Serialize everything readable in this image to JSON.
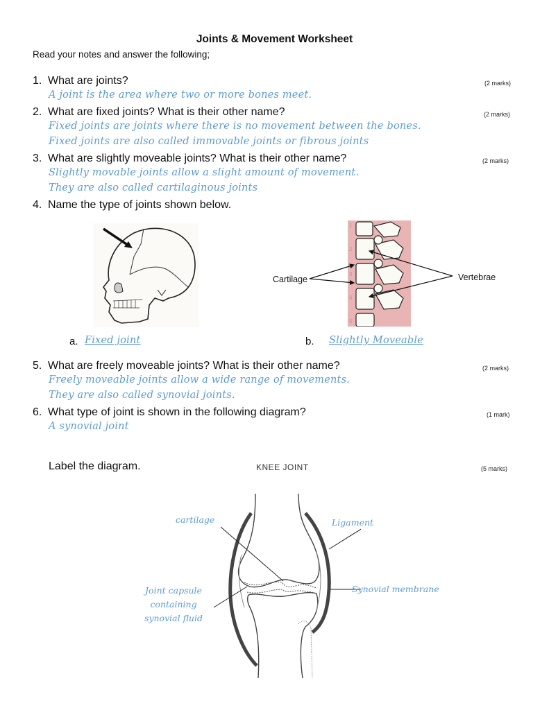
{
  "title": "Joints & Movement Worksheet",
  "intro": "Read your notes and answer the following;",
  "questions": [
    {
      "num": "1.",
      "text": "What are joints?",
      "marks": "(2 marks)",
      "answers": [
        "A joint is the area where two or more bones meet."
      ]
    },
    {
      "num": "2.",
      "text": "What are fixed joints? What is their other name?",
      "marks": "(2 marks)",
      "answers": [
        "Fixed joints are joints where there is no movement between the bones.",
        "Fixed joints are also called immovable joints or fibrous joints"
      ]
    },
    {
      "num": "3.",
      "text": "What are slightly moveable joints? What is their other name?",
      "marks": "(2 marks)",
      "answers": [
        "Slightly movable joints allow a slight amount of movement.",
        "They are also called cartilaginous joints"
      ]
    },
    {
      "num": "4.",
      "text": "Name the type of joints shown below."
    },
    {
      "num": "5.",
      "text": "What are freely moveable joints? What is their other name?",
      "marks": "(2 marks)",
      "answers": [
        "Freely moveable joints allow a wide range of movements.",
        "They are also called synovial joints."
      ]
    },
    {
      "num": "6.",
      "text": "What type of joint is shown in the following diagram?",
      "marks": "(1 mark)",
      "answers": [
        "A synovial joint"
      ]
    }
  ],
  "q4": {
    "a_label": "a.",
    "a_answer": "Fixed joint",
    "b_label": "b.",
    "b_answer": "Slightly Moveable",
    "spine_labels": {
      "cartilage": "Cartilage",
      "vertebrae": "Vertebrae"
    },
    "spine_numbers": [
      "1",
      "2",
      "3",
      "4",
      "5"
    ]
  },
  "label_section": {
    "instruction": "Label the diagram.",
    "marks": "(5 marks)",
    "diagram_title": "KNEE JOINT",
    "labels": {
      "cartilage": "cartilage",
      "ligament": "Ligament",
      "capsule": [
        "Joint capsule",
        "containing",
        "synovial fluid"
      ],
      "membrane": "Synovial membrane"
    }
  },
  "colors": {
    "answer": "#5b9bd5",
    "spine_bg": "#e8b4b4"
  }
}
